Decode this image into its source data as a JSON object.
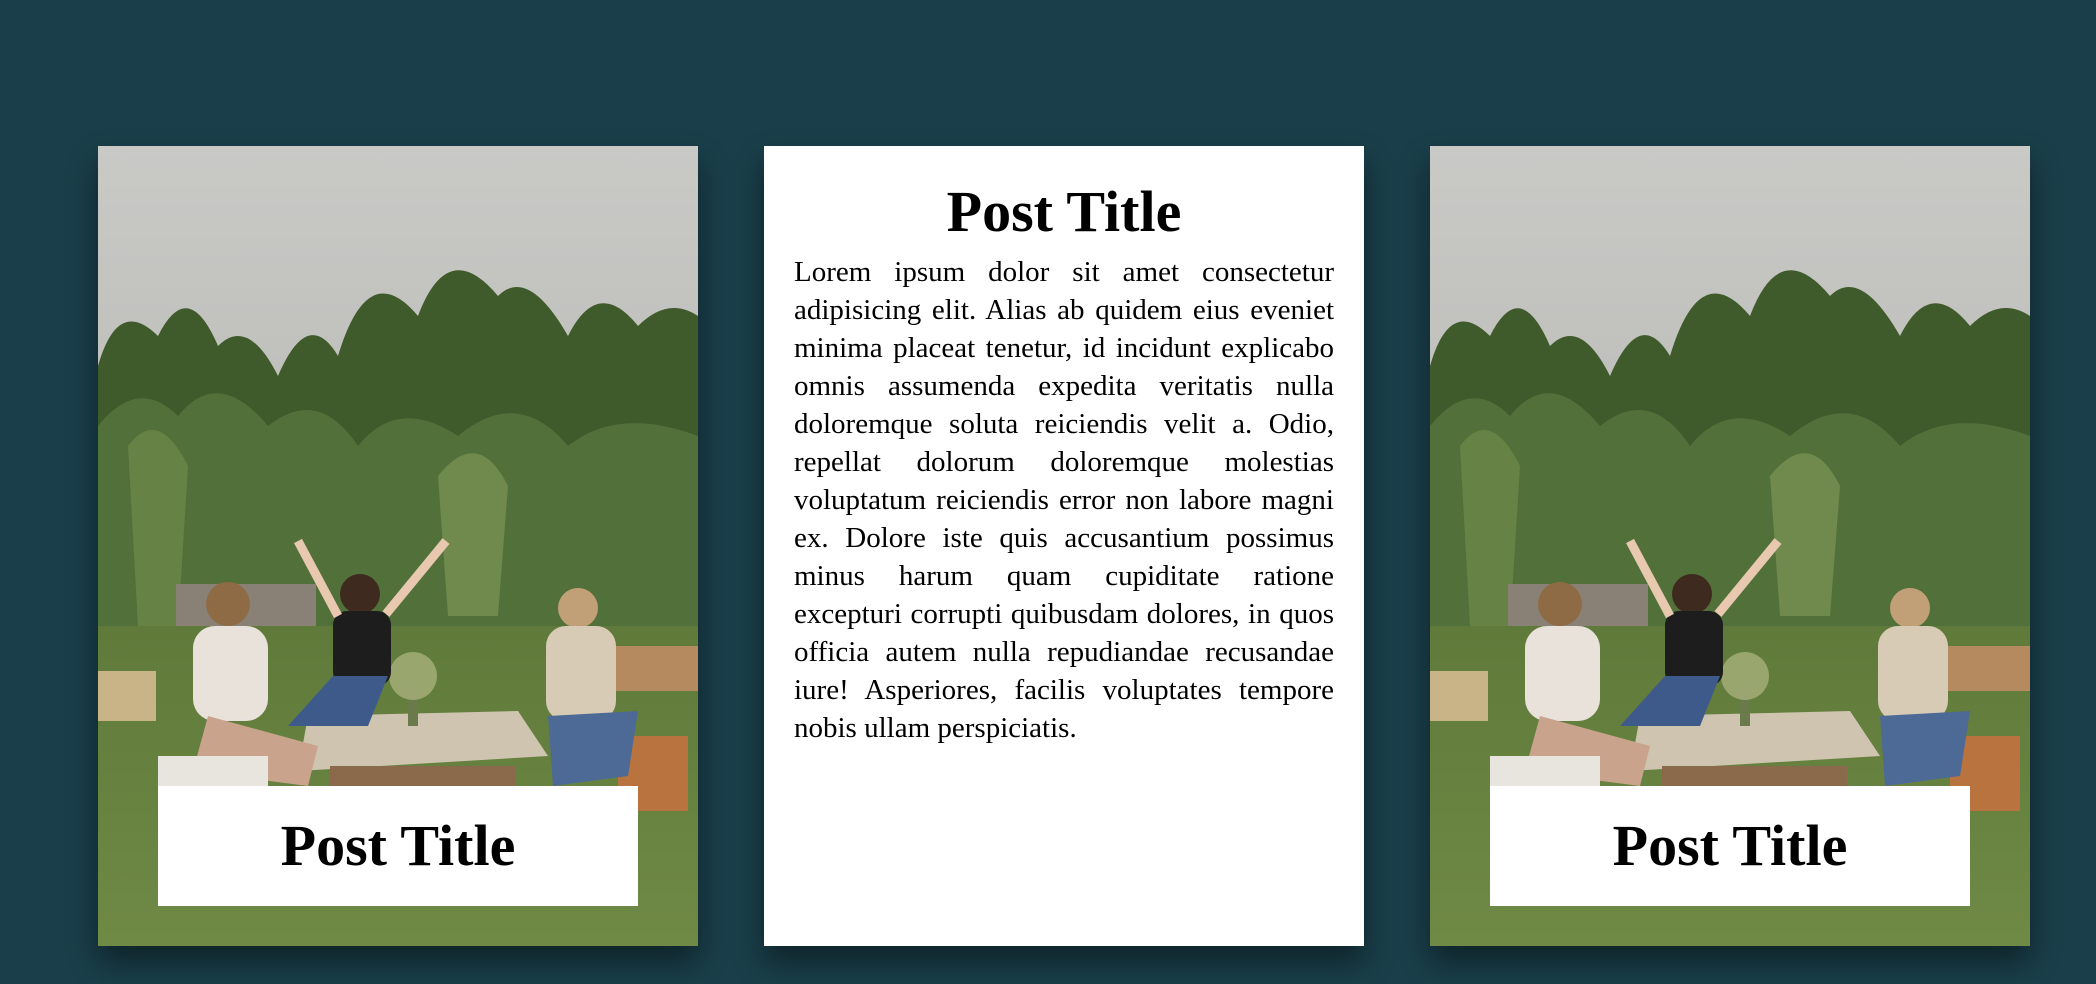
{
  "colors": {
    "background": "#1a3f4a",
    "card": "#ffffff",
    "text": "#000000"
  },
  "cards": [
    {
      "type": "image",
      "image": "outdoor-friends-photo",
      "title": "Post Title"
    },
    {
      "type": "text",
      "title": "Post Title",
      "body": "Lorem ipsum dolor sit amet consectetur adipisicing elit. Alias ab quidem eius eveniet minima placeat tenetur, id incidunt explicabo omnis assumenda expedita veritatis nulla doloremque soluta reiciendis velit a. Odio, repellat dolorum doloremque molestias voluptatum reiciendis error non labore magni ex. Dolore iste quis accusantium possimus minus harum quam cupiditate ratione excepturi corrupti quibusdam dolores, in quos officia autem nulla repudiandae recusandae iure! Asperiores, facilis voluptates tempore nobis ullam perspiciatis."
    },
    {
      "type": "image",
      "image": "outdoor-friends-photo",
      "title": "Post Title"
    }
  ]
}
